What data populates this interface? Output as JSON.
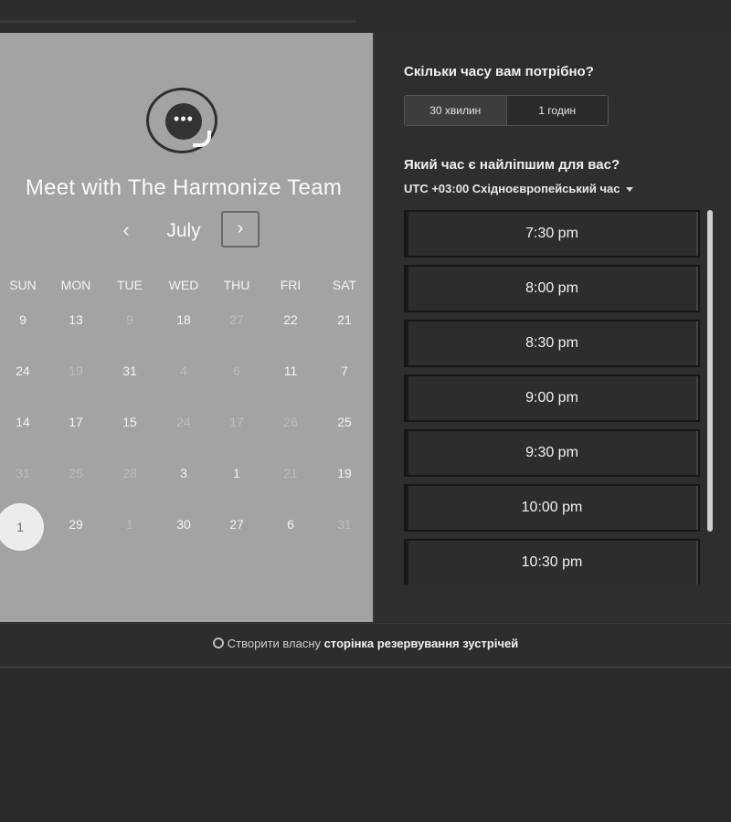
{
  "header": {
    "title": "Meet with The Harmonize Team"
  },
  "calendar": {
    "month": "July",
    "prev_icon": "chevron-left-icon",
    "next_icon": "chevron-right-icon",
    "prev_glyph": "‹",
    "next_glyph": "›",
    "weekdays": [
      "SUN",
      "MON",
      "TUE",
      "WED",
      "THU",
      "FRI",
      "SAT"
    ],
    "weeks": [
      [
        "9",
        "13",
        "9",
        "18",
        "27",
        "22",
        "21"
      ],
      [
        "24",
        "19",
        "31",
        "4",
        "6",
        "11",
        "7"
      ],
      [
        "14",
        "17",
        "15",
        "24",
        "17",
        "26",
        "25"
      ],
      [
        "31",
        "25",
        "28",
        "3",
        "1",
        "21",
        "19"
      ],
      [
        "1",
        "29",
        "1",
        "30",
        "27",
        "6",
        "31"
      ]
    ],
    "selected": "1"
  },
  "duration": {
    "question": "Скільки часу вам потрібно?",
    "options": [
      "30 хвилин",
      "1 годин"
    ]
  },
  "time": {
    "question": "Який час є найліпшим для вас?",
    "timezone": "UTC +03:00 Східноєвропейський час",
    "slots": [
      "7:30 pm",
      "8:00 pm",
      "8:30 pm",
      "9:00 pm",
      "9:30 pm",
      "10:00 pm",
      "10:30 pm"
    ]
  },
  "footer": {
    "prefix": "Створити власну",
    "link": "сторінка резервування зустрічей"
  },
  "colors": {
    "left_panel": "#a3a3a3",
    "right_panel": "#2e2e2e",
    "selected_day": "#ececec"
  }
}
